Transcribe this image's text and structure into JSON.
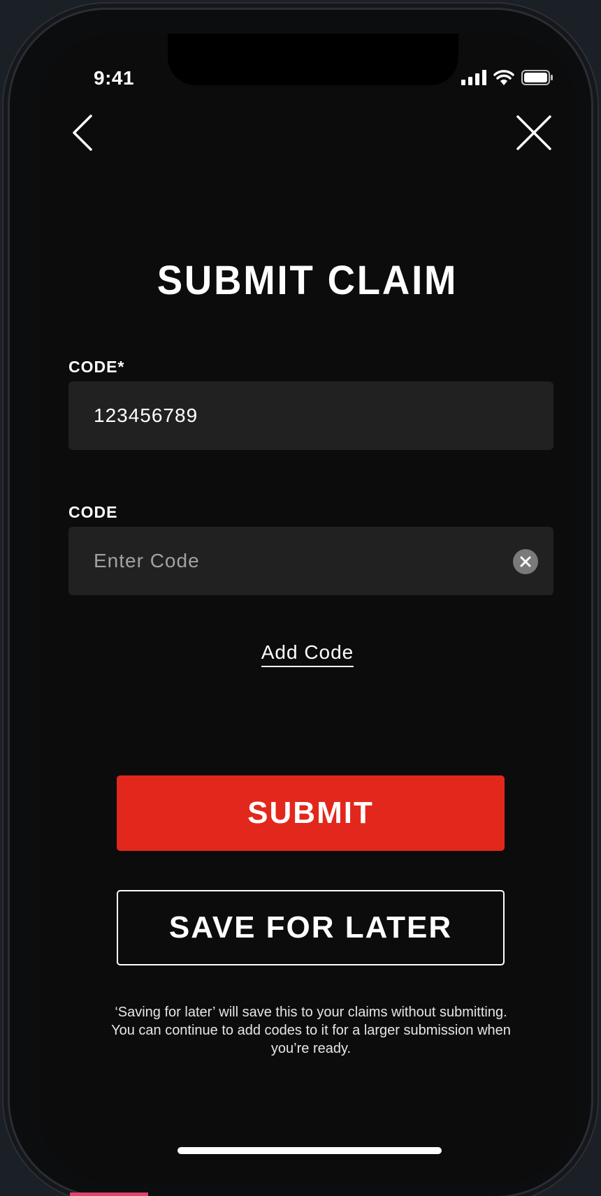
{
  "status_bar": {
    "time": "9:41",
    "signal_icon": "cellular-signal-icon",
    "wifi_icon": "wifi-icon",
    "battery_icon": "battery-icon"
  },
  "nav": {
    "back_icon": "chevron-left-icon",
    "close_icon": "close-icon"
  },
  "page": {
    "title": "SUBMIT CLAIM"
  },
  "form": {
    "fields": [
      {
        "label": "CODE*",
        "value": "123456789",
        "placeholder": ""
      },
      {
        "label": "CODE",
        "value": "",
        "placeholder": "Enter Code",
        "clear_icon": "clear-circle-icon"
      }
    ],
    "add_code_label": "Add Code"
  },
  "actions": {
    "submit_label": "SUBMIT",
    "save_later_label": "SAVE FOR LATER",
    "note": "‘Saving for later’ will save this to your claims without submitting. You can continue to add codes to it for a larger submission when you’re ready."
  },
  "colors": {
    "background": "#0c0c0c",
    "field_background": "#212121",
    "accent": "#e2271c",
    "text": "#ffffff"
  }
}
